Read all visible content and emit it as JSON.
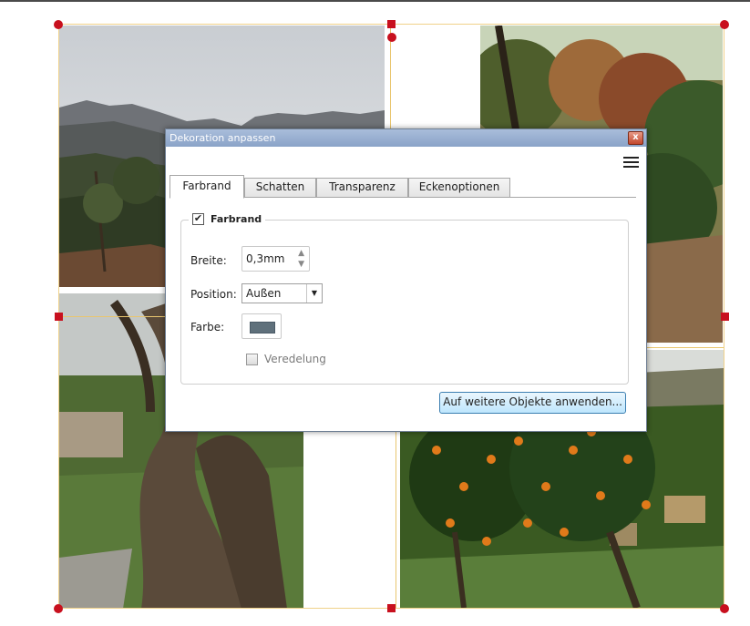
{
  "dialog": {
    "title": "Dekoration anpassen",
    "close_symbol": "x",
    "tabs": [
      {
        "label": "Farbrand",
        "active": true
      },
      {
        "label": "Schatten",
        "active": false
      },
      {
        "label": "Transparenz",
        "active": false
      },
      {
        "label": "Eckenoptionen",
        "active": false
      }
    ],
    "group": {
      "checked": true,
      "label": "Farbrand",
      "check_symbol": "✔"
    },
    "width": {
      "label": "Breite:",
      "value": "0,3mm"
    },
    "position": {
      "label": "Position:",
      "value": "Außen"
    },
    "color": {
      "label": "Farbe:",
      "swatch": "#5f707b"
    },
    "veredelung": {
      "label": "Veredelung",
      "checked": false
    },
    "apply_button": "Auf weitere Objekte anwenden..."
  },
  "selection": {
    "handle_color": "#c8101e",
    "frame_color": "#e9c66f"
  },
  "photos": [
    {
      "id": "mountain-landscape"
    },
    {
      "id": "forest-trail"
    },
    {
      "id": "olive-tree"
    },
    {
      "id": "orange-grove"
    }
  ]
}
